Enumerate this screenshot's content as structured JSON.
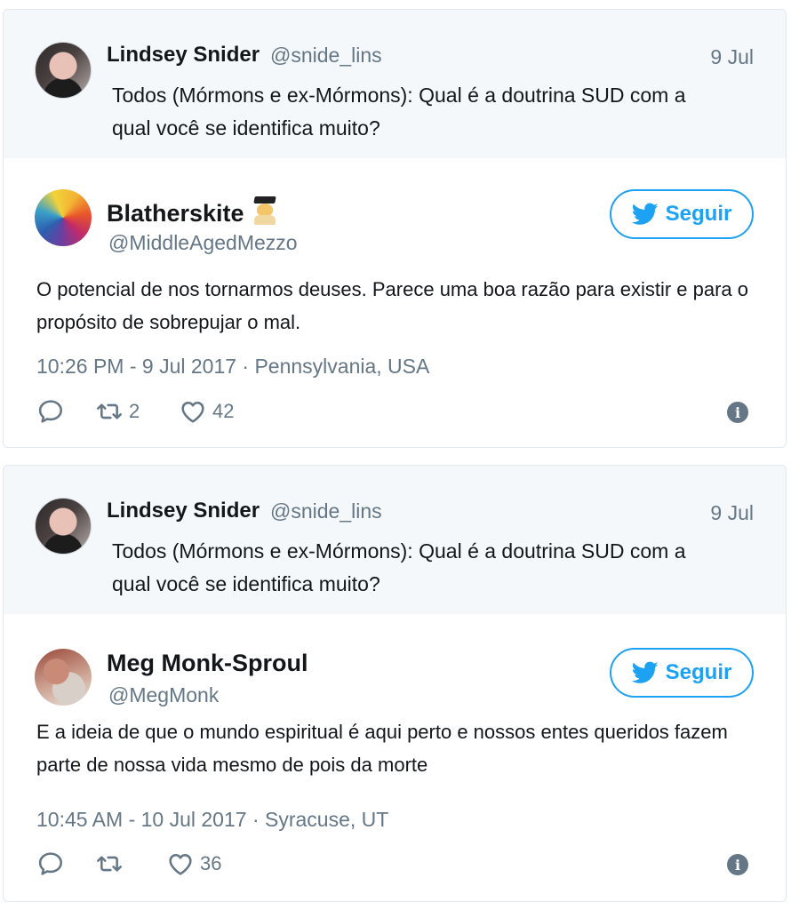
{
  "tweets": [
    {
      "parent": {
        "name": "Lindsey Snider",
        "handle": "@snide_lins",
        "date": "9 Jul",
        "text": "Todos (Mórmons e ex-Mórmons): Qual é a doutrina SUD com a qual você se identifica muito?"
      },
      "reply": {
        "name": "Blatherskite",
        "handle": "@MiddleAgedMezzo",
        "follow_label": "Seguir",
        "text": "O potencial de nos tornarmos deuses. Parece uma boa razão para existir e para o propósito de sobrepujar o mal.",
        "meta": "10:26 PM - 9 Jul 2017 · Pennsylvania, USA",
        "retweets": "2",
        "likes": "42"
      }
    },
    {
      "parent": {
        "name": "Lindsey Snider",
        "handle": "@snide_lins",
        "date": "9 Jul",
        "text": "Todos (Mórmons e ex-Mórmons): Qual é a doutrina SUD com a qual você se identifica muito?"
      },
      "reply": {
        "name": "Meg Monk-Sproul",
        "handle": "@MegMonk",
        "follow_label": "Seguir",
        "text": "E a ideia de que o mundo espiritual é aqui perto e nossos entes queridos fazem parte de nossa vida mesmo de pois da morte",
        "meta": "10:45 AM - 10 Jul 2017 · Syracuse, UT",
        "retweets": "",
        "likes": "36"
      }
    }
  ],
  "colors": {
    "accent": "#1da1f2",
    "muted": "#657786",
    "text": "#14171a",
    "parent_bg": "#f5f8fa"
  },
  "icons": [
    "reply-icon",
    "retweet-icon",
    "like-icon",
    "info-icon",
    "twitter-bird-icon",
    "graduate-emoji-icon"
  ]
}
